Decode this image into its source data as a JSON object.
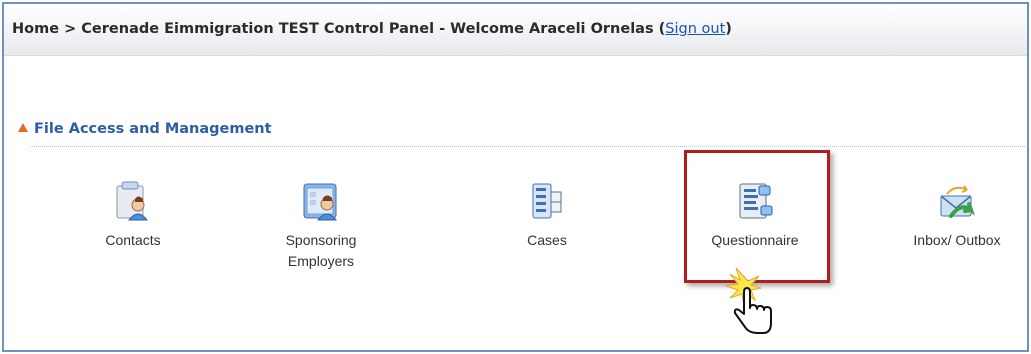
{
  "header": {
    "breadcrumb_text": "Home > Cerenade Eimmigration TEST Control Panel - Welcome Araceli Ornelas (",
    "signout_label": "Sign out",
    "breadcrumb_close": ")"
  },
  "section": {
    "title": "File Access and Management"
  },
  "tiles": [
    {
      "label": "Contacts",
      "icon": "contacts-icon"
    },
    {
      "label_line1": "Sponsoring",
      "label_line2": "Employers",
      "icon": "sponsoring-employers-icon"
    },
    {
      "label": "Cases",
      "icon": "cases-icon"
    },
    {
      "label": "Questionnaire",
      "icon": "questionnaire-icon"
    },
    {
      "label": "Inbox/ Outbox",
      "icon": "inbox-outbox-icon"
    }
  ],
  "colors": {
    "frame_border": "#6f8fc5",
    "section_title": "#2c5ea3",
    "section_triangle": "#e8692a",
    "highlight_border": "#b21c1c",
    "link": "#1a52b5"
  }
}
